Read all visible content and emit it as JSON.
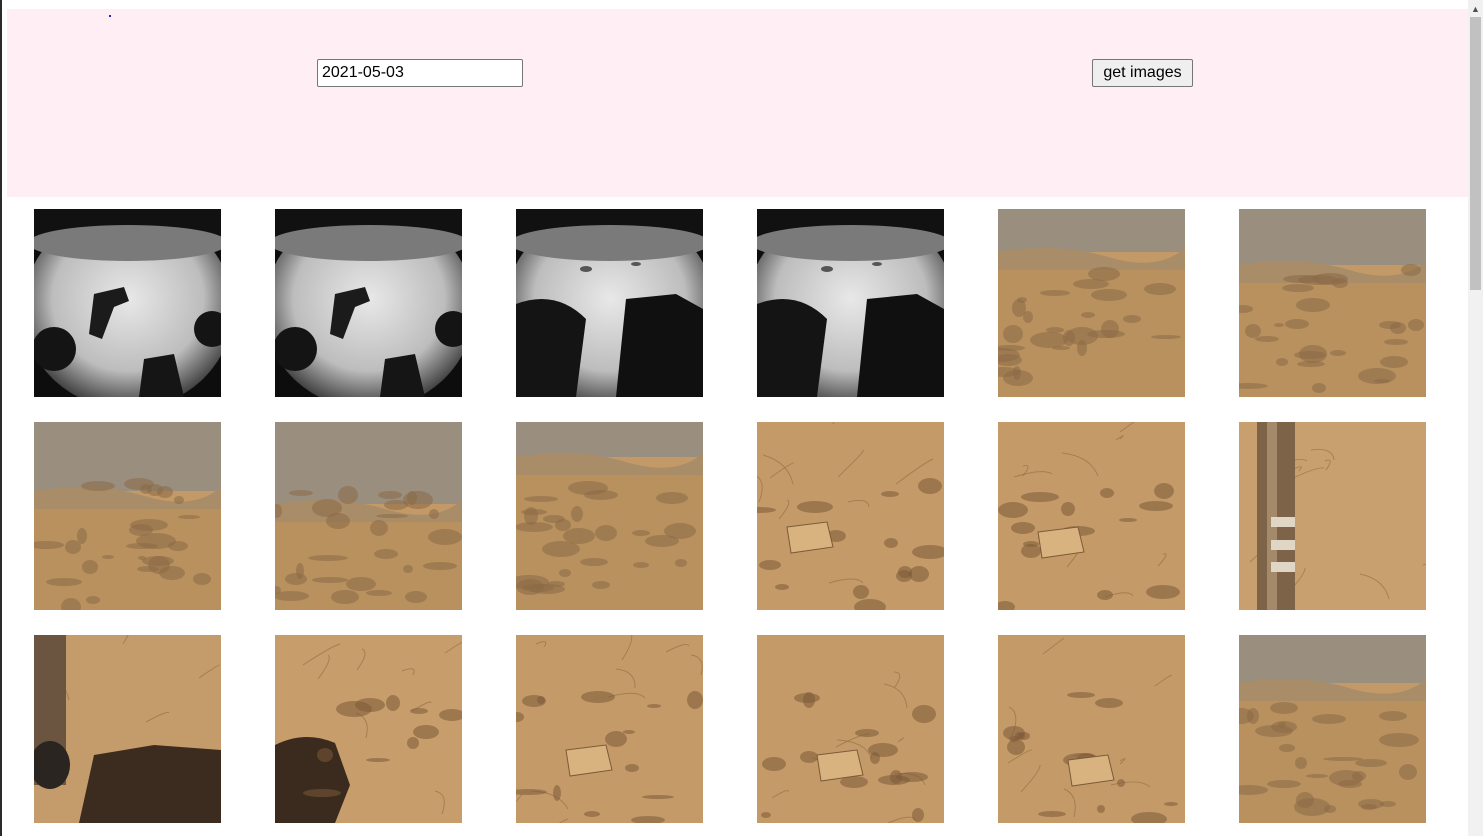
{
  "search": {
    "date_value": "2021-05-03",
    "button_label": "get images"
  },
  "gallery": {
    "images": [
      {
        "kind": "hazcam",
        "variant": 1
      },
      {
        "kind": "hazcam",
        "variant": 1
      },
      {
        "kind": "hazcam",
        "variant": 2
      },
      {
        "kind": "hazcam",
        "variant": 2
      },
      {
        "kind": "terrain-horizon",
        "variant": 1
      },
      {
        "kind": "terrain-horizon",
        "variant": 2
      },
      {
        "kind": "terrain-horizon",
        "variant": 3
      },
      {
        "kind": "terrain-horizon",
        "variant": 4
      },
      {
        "kind": "terrain-horizon",
        "variant": 5
      },
      {
        "kind": "rocky-ground",
        "variant": 1
      },
      {
        "kind": "rocky-ground",
        "variant": 2
      },
      {
        "kind": "rover-arm",
        "variant": 1
      },
      {
        "kind": "rover-arm-shadow",
        "variant": 1
      },
      {
        "kind": "ground-shadow",
        "variant": 1
      },
      {
        "kind": "rocky-ground",
        "variant": 3
      },
      {
        "kind": "rocky-ground",
        "variant": 4
      },
      {
        "kind": "rocky-ground",
        "variant": 5
      },
      {
        "kind": "terrain-horizon",
        "variant": 6
      }
    ]
  },
  "colors": {
    "header_background": "#ffeef3",
    "mars_soil": "#c39a67",
    "mars_soil_dark": "#8a6a45",
    "mars_sky": "#9a8f7e"
  }
}
